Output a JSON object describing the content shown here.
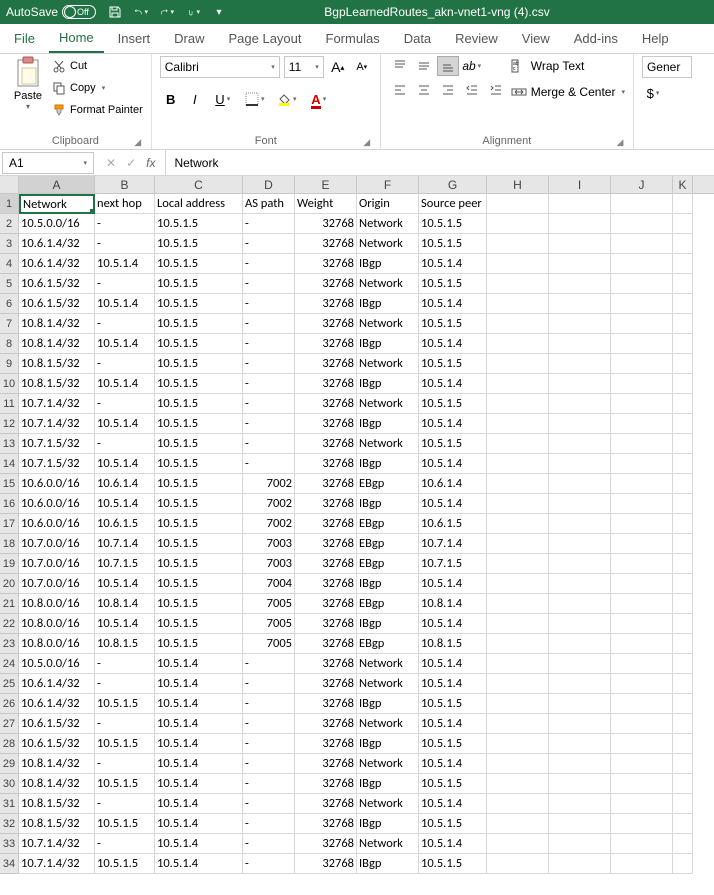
{
  "titlebar": {
    "autosave": "AutoSave",
    "autosave_state": "Off",
    "filename": "BgpLearnedRoutes_akn-vnet1-vng (4).csv"
  },
  "tabs": {
    "file": "File",
    "home": "Home",
    "insert": "Insert",
    "draw": "Draw",
    "page_layout": "Page Layout",
    "formulas": "Formulas",
    "data": "Data",
    "review": "Review",
    "view": "View",
    "addins": "Add-ins",
    "help": "Help"
  },
  "ribbon": {
    "paste": "Paste",
    "cut": "Cut",
    "copy": "Copy",
    "format_painter": "Format Painter",
    "clipboard_label": "Clipboard",
    "font_name": "Calibri",
    "font_size": "11",
    "font_label": "Font",
    "wrap_text": "Wrap Text",
    "merge_center": "Merge & Center",
    "alignment_label": "Alignment",
    "general": "Gener"
  },
  "formula_bar": {
    "namebox": "A1",
    "formula": "Network"
  },
  "columns": [
    "A",
    "B",
    "C",
    "D",
    "E",
    "F",
    "G",
    "H",
    "I",
    "J",
    "K"
  ],
  "headers": [
    "Network",
    "next hop",
    "Local address",
    "AS path",
    "Weight",
    "Origin",
    "Source peer"
  ],
  "rows": [
    [
      "10.5.0.0/16",
      "-",
      "10.5.1.5",
      "-",
      "32768",
      "Network",
      "10.5.1.5"
    ],
    [
      "10.6.1.4/32",
      "-",
      "10.5.1.5",
      "-",
      "32768",
      "Network",
      "10.5.1.5"
    ],
    [
      "10.6.1.4/32",
      "10.5.1.4",
      "10.5.1.5",
      "-",
      "32768",
      "IBgp",
      "10.5.1.4"
    ],
    [
      "10.6.1.5/32",
      "-",
      "10.5.1.5",
      "-",
      "32768",
      "Network",
      "10.5.1.5"
    ],
    [
      "10.6.1.5/32",
      "10.5.1.4",
      "10.5.1.5",
      "-",
      "32768",
      "IBgp",
      "10.5.1.4"
    ],
    [
      "10.8.1.4/32",
      "-",
      "10.5.1.5",
      "-",
      "32768",
      "Network",
      "10.5.1.5"
    ],
    [
      "10.8.1.4/32",
      "10.5.1.4",
      "10.5.1.5",
      "-",
      "32768",
      "IBgp",
      "10.5.1.4"
    ],
    [
      "10.8.1.5/32",
      "-",
      "10.5.1.5",
      "-",
      "32768",
      "Network",
      "10.5.1.5"
    ],
    [
      "10.8.1.5/32",
      "10.5.1.4",
      "10.5.1.5",
      "-",
      "32768",
      "IBgp",
      "10.5.1.4"
    ],
    [
      "10.7.1.4/32",
      "-",
      "10.5.1.5",
      "-",
      "32768",
      "Network",
      "10.5.1.5"
    ],
    [
      "10.7.1.4/32",
      "10.5.1.4",
      "10.5.1.5",
      "-",
      "32768",
      "IBgp",
      "10.5.1.4"
    ],
    [
      "10.7.1.5/32",
      "-",
      "10.5.1.5",
      "-",
      "32768",
      "Network",
      "10.5.1.5"
    ],
    [
      "10.7.1.5/32",
      "10.5.1.4",
      "10.5.1.5",
      "-",
      "32768",
      "IBgp",
      "10.5.1.4"
    ],
    [
      "10.6.0.0/16",
      "10.6.1.4",
      "10.5.1.5",
      "7002",
      "32768",
      "EBgp",
      "10.6.1.4"
    ],
    [
      "10.6.0.0/16",
      "10.5.1.4",
      "10.5.1.5",
      "7002",
      "32768",
      "IBgp",
      "10.5.1.4"
    ],
    [
      "10.6.0.0/16",
      "10.6.1.5",
      "10.5.1.5",
      "7002",
      "32768",
      "EBgp",
      "10.6.1.5"
    ],
    [
      "10.7.0.0/16",
      "10.7.1.4",
      "10.5.1.5",
      "7003",
      "32768",
      "EBgp",
      "10.7.1.4"
    ],
    [
      "10.7.0.0/16",
      "10.7.1.5",
      "10.5.1.5",
      "7003",
      "32768",
      "EBgp",
      "10.7.1.5"
    ],
    [
      "10.7.0.0/16",
      "10.5.1.4",
      "10.5.1.5",
      "7004",
      "32768",
      "IBgp",
      "10.5.1.4"
    ],
    [
      "10.8.0.0/16",
      "10.8.1.4",
      "10.5.1.5",
      "7005",
      "32768",
      "EBgp",
      "10.8.1.4"
    ],
    [
      "10.8.0.0/16",
      "10.5.1.4",
      "10.5.1.5",
      "7005",
      "32768",
      "IBgp",
      "10.5.1.4"
    ],
    [
      "10.8.0.0/16",
      "10.8.1.5",
      "10.5.1.5",
      "7005",
      "32768",
      "EBgp",
      "10.8.1.5"
    ],
    [
      "10.5.0.0/16",
      "-",
      "10.5.1.4",
      "-",
      "32768",
      "Network",
      "10.5.1.4"
    ],
    [
      "10.6.1.4/32",
      "-",
      "10.5.1.4",
      "-",
      "32768",
      "Network",
      "10.5.1.4"
    ],
    [
      "10.6.1.4/32",
      "10.5.1.5",
      "10.5.1.4",
      "-",
      "32768",
      "IBgp",
      "10.5.1.5"
    ],
    [
      "10.6.1.5/32",
      "-",
      "10.5.1.4",
      "-",
      "32768",
      "Network",
      "10.5.1.4"
    ],
    [
      "10.6.1.5/32",
      "10.5.1.5",
      "10.5.1.4",
      "-",
      "32768",
      "IBgp",
      "10.5.1.5"
    ],
    [
      "10.8.1.4/32",
      "-",
      "10.5.1.4",
      "-",
      "32768",
      "Network",
      "10.5.1.4"
    ],
    [
      "10.8.1.4/32",
      "10.5.1.5",
      "10.5.1.4",
      "-",
      "32768",
      "IBgp",
      "10.5.1.5"
    ],
    [
      "10.8.1.5/32",
      "-",
      "10.5.1.4",
      "-",
      "32768",
      "Network",
      "10.5.1.4"
    ],
    [
      "10.8.1.5/32",
      "10.5.1.5",
      "10.5.1.4",
      "-",
      "32768",
      "IBgp",
      "10.5.1.5"
    ],
    [
      "10.7.1.4/32",
      "-",
      "10.5.1.4",
      "-",
      "32768",
      "Network",
      "10.5.1.4"
    ],
    [
      "10.7.1.4/32",
      "10.5.1.5",
      "10.5.1.4",
      "-",
      "32768",
      "IBgp",
      "10.5.1.5"
    ]
  ]
}
